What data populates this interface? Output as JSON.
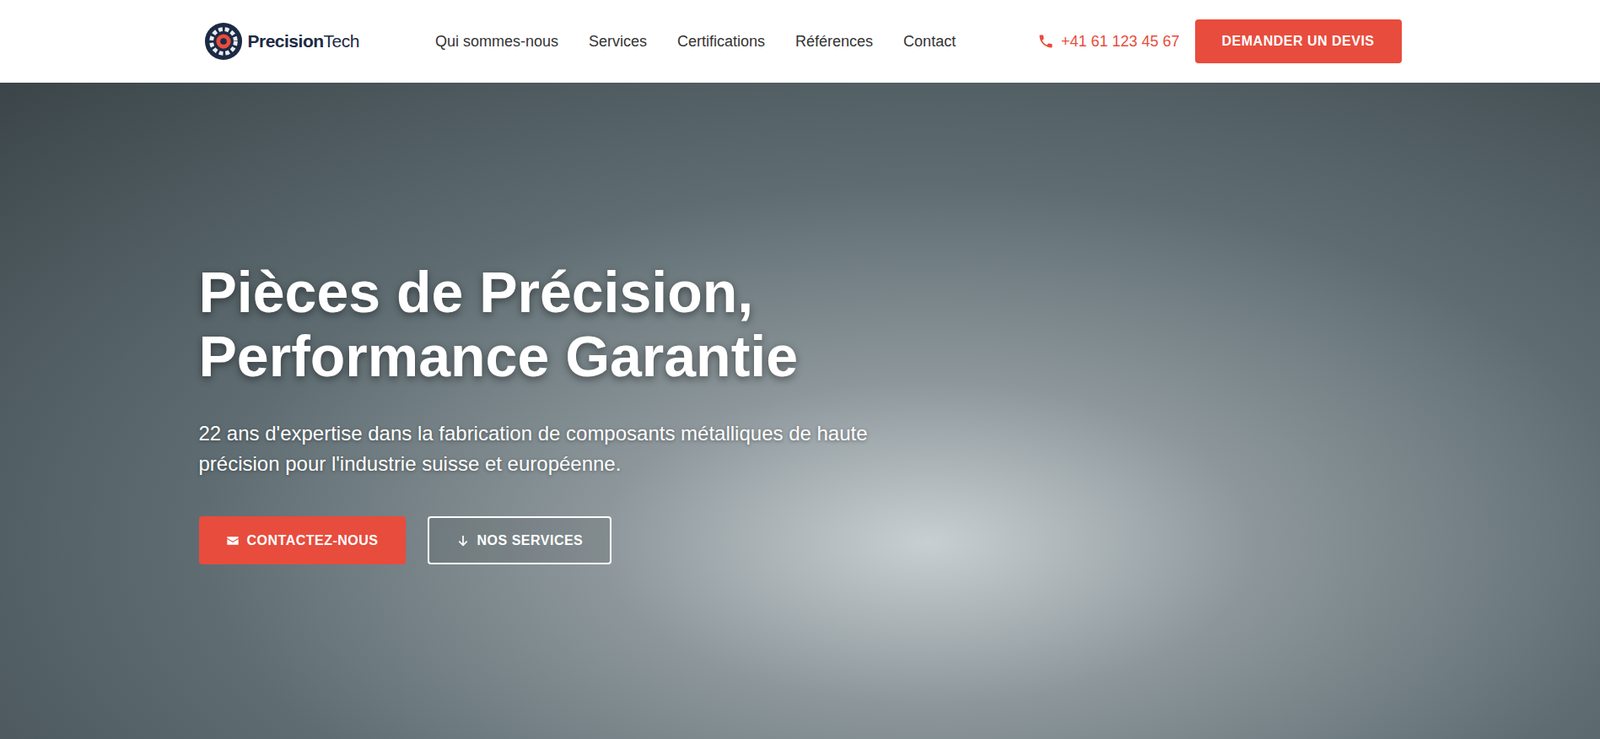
{
  "header": {
    "logo": {
      "name_bold": "Precision",
      "name_light": "Tech"
    },
    "nav": [
      {
        "label": "Qui sommes-nous",
        "selected": false
      },
      {
        "label": "Services",
        "selected": false
      },
      {
        "label": "Certifications",
        "selected": false
      },
      {
        "label": "Références",
        "selected": false
      },
      {
        "label": "Contact",
        "selected": false
      }
    ],
    "phone": "+41 61 123 45 67",
    "quote_button": "DEMANDER UN DEVIS"
  },
  "hero": {
    "title_lines": [
      "Pièces de Précision,",
      "Performance Garantie"
    ],
    "subtitle": "22 ans d'expertise dans la fabrication de composants métalliques de haute précision pour l'industrie suisse et européenne.",
    "buttons": [
      {
        "label": "CONTACTEZ-NOUS",
        "kind": "primary"
      },
      {
        "label": "NOS SERVICES",
        "kind": "outline"
      }
    ]
  }
}
